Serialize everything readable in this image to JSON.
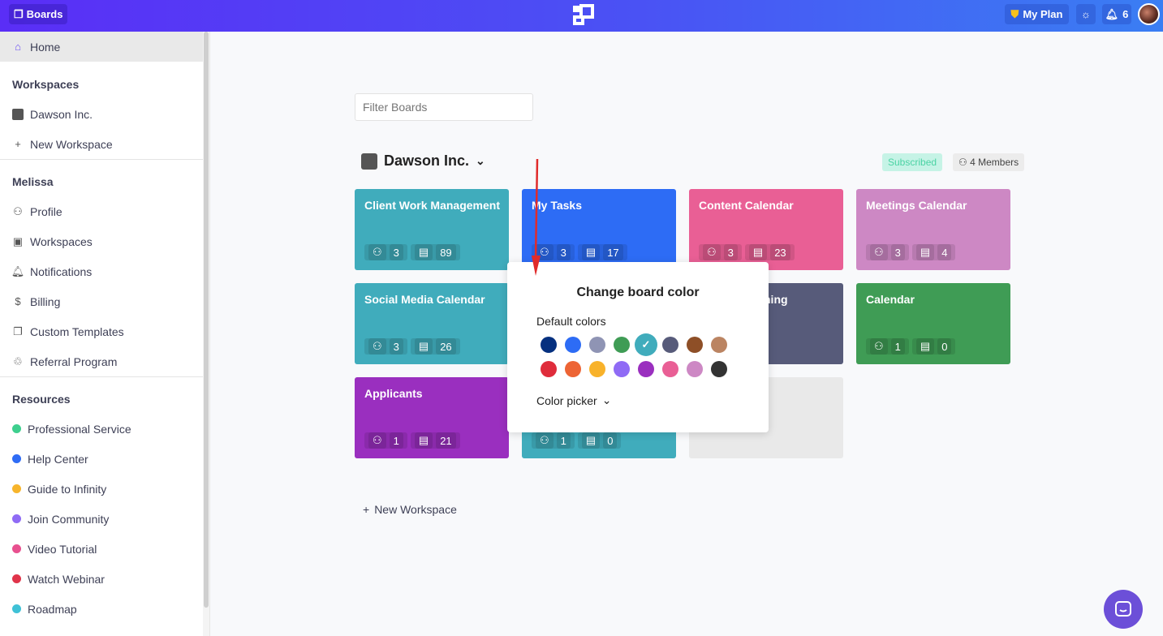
{
  "topbar": {
    "boards_label": "Boards",
    "my_plan_label": "My Plan",
    "notifications_count": "6"
  },
  "sidebar": {
    "home": "Home",
    "workspaces_header": "Workspaces",
    "workspaces": [
      {
        "label": "Dawson Inc."
      },
      {
        "label": "New Workspace"
      }
    ],
    "user_header": "Melissa",
    "user_items": [
      {
        "label": "Profile",
        "icon": "user-icon"
      },
      {
        "label": "Workspaces",
        "icon": "briefcase-icon"
      },
      {
        "label": "Notifications",
        "icon": "bell-icon"
      },
      {
        "label": "Billing",
        "icon": "dollar-icon"
      },
      {
        "label": "Custom Templates",
        "icon": "template-icon"
      },
      {
        "label": "Referral Program",
        "icon": "recycle-icon"
      }
    ],
    "resources_header": "Resources",
    "resources": [
      {
        "label": "Professional Service",
        "color": "#3ecf8e"
      },
      {
        "label": "Help Center",
        "color": "#2f6cf5"
      },
      {
        "label": "Guide to Infinity",
        "color": "#f7b52c"
      },
      {
        "label": "Join Community",
        "color": "#8f6bf5"
      },
      {
        "label": "Video Tutorial",
        "color": "#e8508f"
      },
      {
        "label": "Watch Webinar",
        "color": "#e0344a"
      },
      {
        "label": "Roadmap",
        "color": "#3fc1d6"
      }
    ]
  },
  "main": {
    "filter_placeholder": "Filter Boards",
    "workspace_name": "Dawson Inc.",
    "subscribed": "Subscribed",
    "members": "4 Members",
    "boards": [
      {
        "title": "Client Work Management",
        "members": "3",
        "items": "89",
        "color": "#40acbc"
      },
      {
        "title": "My Tasks",
        "members": "3",
        "items": "17",
        "color": "#2d6cf5"
      },
      {
        "title": "Content Calendar",
        "members": "3",
        "items": "23",
        "color": "#e95f95"
      },
      {
        "title": "Meetings Calendar",
        "members": "3",
        "items": "4",
        "color": "#cd88c4"
      },
      {
        "title": "Social Media Calendar",
        "members": "3",
        "items": "26",
        "color": "#40acbc"
      },
      {
        "title": "",
        "members": "",
        "items": "",
        "color": "#40acbc"
      },
      {
        "title": "ning",
        "members": "",
        "items": "",
        "color": "#575b7a"
      },
      {
        "title": "Calendar",
        "members": "1",
        "items": "0",
        "color": "#3f9c55"
      },
      {
        "title": "Applicants",
        "members": "1",
        "items": "21",
        "color": "#9a2fbf"
      },
      {
        "title": "",
        "members": "1",
        "items": "0",
        "color": "#40acbc"
      }
    ],
    "new_workspace": "New Workspace"
  },
  "popup": {
    "title": "Change board color",
    "default_colors_label": "Default colors",
    "selected": "#40acbc",
    "colors": [
      "#05307f",
      "#2d6cf5",
      "#8f94b4",
      "#3f9c55",
      "#40acbc",
      "#575b7a",
      "#8e4f27",
      "#bb8462",
      "#df2c3b",
      "#ed6434",
      "#f8b22a",
      "#8f6bf5",
      "#9a2fbf",
      "#e95f95",
      "#cd88c4",
      "#333333"
    ],
    "color_picker_label": "Color picker"
  }
}
